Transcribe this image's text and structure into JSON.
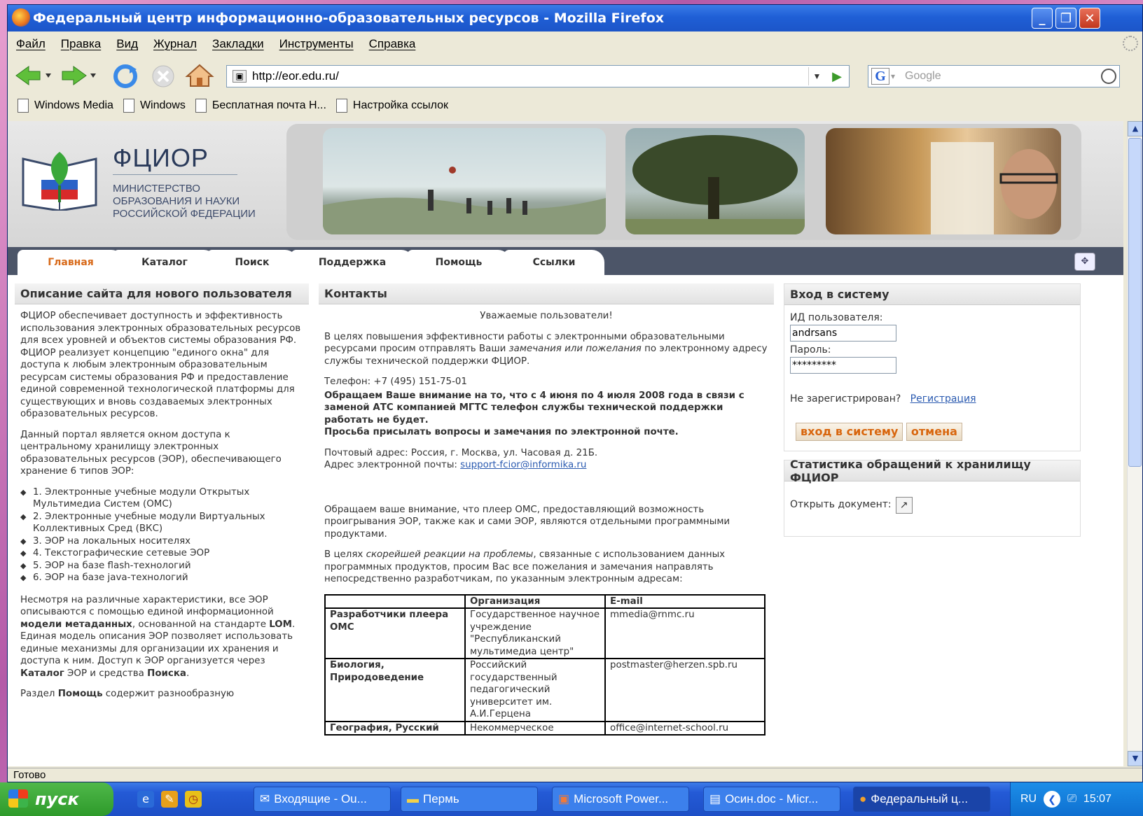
{
  "window": {
    "title": "Федеральный центр информационно-образовательных ресурсов - Mozilla Firefox",
    "min_symbol": "_",
    "max_symbol": "❐",
    "close_symbol": "✕"
  },
  "menu": [
    "Файл",
    "Правка",
    "Вид",
    "Журнал",
    "Закладки",
    "Инструменты",
    "Справка"
  ],
  "nav": {
    "url": "http://eor.edu.ru/",
    "search_placeholder": "Google"
  },
  "bookmarks": [
    "Windows Media",
    "Windows",
    "Бесплатная почта Н...",
    "Настройка ссылок"
  ],
  "site": {
    "logo_title": "ФЦИОР",
    "logo_sub": [
      "МИНИСТЕРСТВО",
      "ОБРАЗОВАНИЯ И НАУКИ",
      "РОССИЙСКОЙ ФЕДЕРАЦИИ"
    ],
    "tabs": [
      "Главная",
      "Каталог",
      "Поиск",
      "Поддержка",
      "Помощь",
      "Ссылки"
    ],
    "active_tab": "Главная",
    "left": {
      "title": "Описание сайта для нового пользователя",
      "p1": "ФЦИОР обеспечивает доступность и эффективность использования электронных образовательных ресурсов для всех уровней и объектов системы образования РФ. ФЦИОР реализует концепцию \"единого окна\" для доступа к любым электронным образовательным ресурсам системы образования РФ и предоставление единой современной технологической платформы для существующих и вновь создаваемых электронных образовательных ресурсов.",
      "p2": "Данный портал является окном доступа к центральному хранилищу электронных образовательных ресурсов (ЭОР), обеспечивающего хранение 6 типов ЭОР:",
      "list": [
        "1. Электронные учебные модули Открытых Мультимедиа Систем (ОМС)",
        "2. Электронные учебные модули Виртуальных Коллективных Сред (ВКС)",
        "3. ЭОР на локальных носителях",
        "4. Текстографические сетевые ЭОР",
        "5. ЭОР на базе flash-технологий",
        "6. ЭОР на базе java-технологий"
      ],
      "p3_a": "Несмотря на различные характеристики, все ЭОР описываются с помощью единой информационной ",
      "p3_b": "модели метаданных",
      "p3_c": ", основанной на стандарте ",
      "p3_d": "LOM",
      "p3_e": ". Единая модель описания ЭОР позволяет использовать единые механизмы для организации их хранения и доступа к ним. Доступ к ЭОР организуется через ",
      "p3_f": "Каталог",
      "p3_g": " ЭОР и средства ",
      "p3_h": "Поиска",
      "p3_i": ".",
      "p4_a": "Раздел ",
      "p4_b": "Помощь",
      "p4_c": " содержит разнообразную"
    },
    "middle": {
      "title": "Контакты",
      "greeting": "Уважаемые пользователи!",
      "p1_a": "В целях повышения эффективности работы с электронными образовательными ресурсами просим отправлять Ваши ",
      "p1_b": "замечания или пожелания",
      "p1_c": " по электронному адресу службы технической поддержки ФЦИОР.",
      "phone": "Телефон: +7 (495) 151-75-01",
      "bold1": "Обращаем Ваше внимание на то, что с 4 июня по 4 июля 2008 года в связи с заменой АТС компанией МГТС телефон службы технической поддержки работать не будет.",
      "bold2": "Просьба присылать вопросы и замечания по электронной почте.",
      "address": "Почтовый адрес: Россия, г. Москва, ул. Часовая д. 21Б.",
      "email_label": "Адрес электронной почты: ",
      "email": "support-fcior@informika.ru",
      "p2": "Обращаем ваше внимание, что плеер ОМС, предоставляющий возможность проигрывания ЭОР, также как и сами ЭОР, являются отдельными программными продуктами.",
      "p3_a": "В целях ",
      "p3_b": "скорейшей реакции на проблемы",
      "p3_c": ", связанные с использованием данных программных продуктов, просим Вас все пожелания и замечания направлять непосредственно разработчикам, по указанным электронным адресам:",
      "table_headers": [
        "",
        "Организация",
        "E-mail"
      ],
      "table_rows": [
        [
          "Разработчики плеера ОМС",
          "Государственное научное учреждение \"Республиканский мультимедиа центр\"",
          "mmedia@rnmc.ru"
        ],
        [
          "Биология, Природоведение",
          "Российский государственный педагогический университет им. А.И.Герцена",
          "postmaster@herzen.spb.ru"
        ],
        [
          "География, Русский",
          "Некоммерческое",
          "office@internet-school.ru"
        ]
      ]
    },
    "right": {
      "login_title": "Вход в систему",
      "user_label": "ИД пользователя:",
      "user_value": "andrsans",
      "pass_label": "Пароль:",
      "pass_value": "*********",
      "not_registered": "Не зарегистрирован?",
      "register_link": "Регистрация",
      "login_button": "вход в систему",
      "cancel_button": "отмена",
      "stats_title": "Статистика обращений к хранилищу ФЦИОР",
      "open_doc": "Открыть документ:"
    }
  },
  "status": "Готово",
  "taskbar": {
    "start": "пуск",
    "tasks": [
      "Входящие - Ou...",
      "Пермь",
      "Microsoft Power...",
      "Осин.doc - Micr...",
      "Федеральный ц..."
    ],
    "lang": "RU",
    "time": "15:07"
  }
}
